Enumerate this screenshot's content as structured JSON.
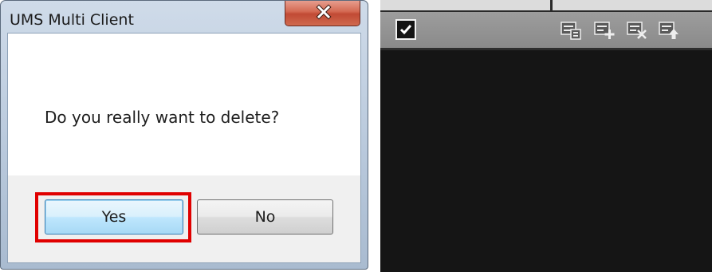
{
  "dialog": {
    "title": "UMS Multi Client",
    "message": "Do you really want to delete?",
    "buttons": {
      "yes_label": "Yes",
      "no_label": "No"
    },
    "close_icon": "close-icon",
    "highlighted_button": "yes"
  },
  "panel": {
    "select_all_checked": true,
    "toolbar_icons": [
      "list-properties-icon",
      "list-add-icon",
      "list-delete-icon",
      "list-move-up-icon"
    ]
  },
  "colors": {
    "highlight": "#e00000",
    "close_button": "#c14a34",
    "panel_background": "#151515",
    "toolbar": "#9d9d9d"
  }
}
